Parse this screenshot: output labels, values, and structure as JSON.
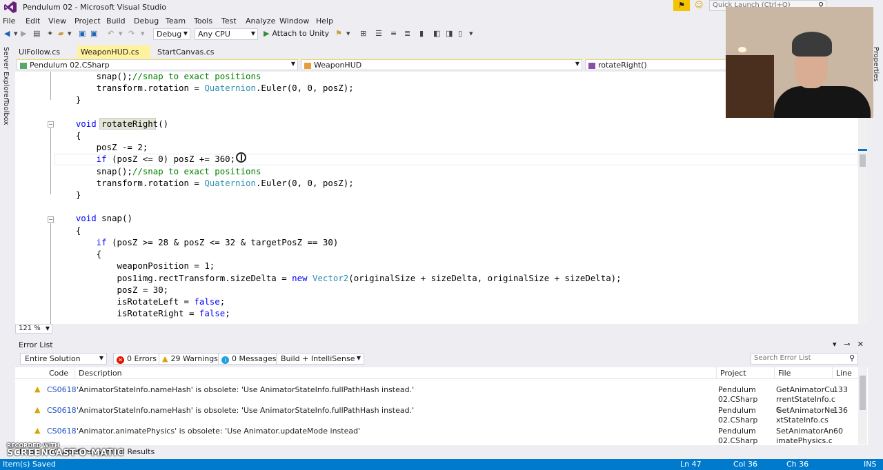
{
  "window": {
    "title": "Pendulum 02 - Microsoft Visual Studio",
    "quick_launch_placeholder": "Quick Launch (Ctrl+Q)"
  },
  "menu": [
    "File",
    "Edit",
    "View",
    "Project",
    "Build",
    "Debug",
    "Team",
    "Tools",
    "Test",
    "Analyze",
    "Window",
    "Help"
  ],
  "toolbar": {
    "config": "Debug",
    "platform": "Any CPU",
    "attach": "Attach to Unity"
  },
  "side_tabs": {
    "server_explorer": "Server Explorer",
    "toolbox": "Toolbox",
    "properties": "Properties"
  },
  "doc_tabs": [
    {
      "label": "UIFollow.cs",
      "active": false
    },
    {
      "label": "WeaponHUD.cs",
      "active": true
    },
    {
      "label": "StartCanvas.cs",
      "active": false
    }
  ],
  "nav": {
    "project": "Pendulum 02.CSharp",
    "class": "WeaponHUD",
    "member": "rotateRight()"
  },
  "code": {
    "l1a": "        snap();",
    "l1b": "//snap to exact positions",
    "l2a": "        transform.rotation = ",
    "l2t": "Quaternion",
    "l2b": ".Euler(0, 0, posZ);",
    "l3": "    }",
    "l4": "",
    "l5k": "    void",
    "l5b": " rotateRight()",
    "l6": "    {",
    "l7": "        posZ -= 2;",
    "l8k": "        if",
    "l8b": " (posZ <= 0) posZ += 360;",
    "l9a": "        snap();",
    "l9b": "//snap to exact positions",
    "l10a": "        transform.rotation = ",
    "l10t": "Quaternion",
    "l10b": ".Euler(0, 0, posZ);",
    "l11": "    }",
    "l12": "",
    "l13k": "    void",
    "l13b": " snap()",
    "l14": "    {",
    "l15k": "        if",
    "l15b": " (posZ >= 28 & posZ <= 32 & targetPosZ == 30)",
    "l16": "        {",
    "l17": "            weaponPosition = 1;",
    "l18a": "            pos1img.rectTransform.sizeDelta = ",
    "l18k": "new",
    "l18sp": " ",
    "l18t": "Vector2",
    "l18b": "(originalSize + sizeDelta, originalSize + sizeDelta);",
    "l19": "            posZ = 30;",
    "l20a": "            isRotateLeft = ",
    "l20k": "false",
    "l20b": ";",
    "l21a": "            isRotateRight = ",
    "l21k": "false",
    "l21b": ";"
  },
  "zoom": "121 %",
  "error_list": {
    "title": "Error List",
    "scope": "Entire Solution",
    "errors": "0 Errors",
    "warnings": "29 Warnings",
    "messages": "0 Messages",
    "build_filter": "Build + IntelliSense",
    "search_placeholder": "Search Error List",
    "columns": {
      "code": "Code",
      "description": "Description",
      "project": "Project",
      "file": "File",
      "line": "Line"
    },
    "rows": [
      {
        "code": "CS0618",
        "description": "'AnimatorStateInfo.nameHash' is obsolete: 'Use AnimatorStateInfo.fullPathHash instead.'",
        "project": "Pendulum 02.CSharp",
        "file": "GetAnimatorCurrentStateInfo.cs",
        "line": "133"
      },
      {
        "code": "CS0618",
        "description": "'AnimatorStateInfo.nameHash' is obsolete: 'Use AnimatorStateInfo.fullPathHash instead.'",
        "project": "Pendulum 02.CSharp",
        "file": "GetAnimatorNextStateInfo.cs",
        "line": "136"
      },
      {
        "code": "CS0618",
        "description": "'Animator.animatePhysics' is obsolete: 'Use Animator.updateMode instead'",
        "project": "Pendulum 02.CSharp",
        "file": "SetAnimatorAnimatePhysics.cs",
        "line": "60"
      }
    ]
  },
  "bottom_tabs": [
    "Error List",
    "Output",
    "Find Symbol Results"
  ],
  "status": {
    "message": "Item(s) Saved",
    "ln": "Ln 47",
    "col": "Col 36",
    "ch": "Ch 36",
    "mode": "INS"
  },
  "watermark": {
    "small": "RECORDED WITH",
    "big": "SCREENCAST-O-MATIC"
  },
  "colors": {
    "accent": "#007acc",
    "active_tab": "#fff29d",
    "keyword": "#0000ff",
    "type": "#2b91af",
    "comment": "#008000",
    "warning": "#d9a400"
  }
}
